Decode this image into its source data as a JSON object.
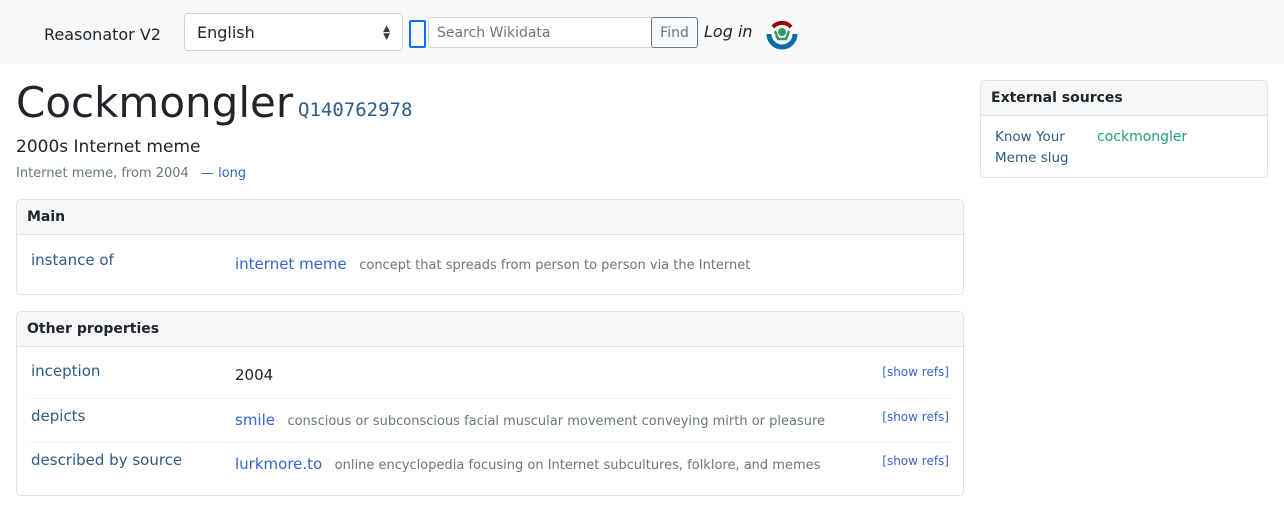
{
  "header": {
    "brand": "Reasonator V2",
    "language": "English",
    "search_placeholder": "Search Wikidata",
    "find_label": "Find",
    "login_label": "Log in"
  },
  "item": {
    "title": "Cockmongler",
    "qid": "Q140762978",
    "subtitle": "2000s Internet meme",
    "description": "Internet meme, from 2004",
    "long_link": "— long"
  },
  "main": {
    "header": "Main",
    "rows": [
      {
        "prop": "instance of",
        "value": "internet meme",
        "desc": "concept that spreads from person to person via the Internet"
      }
    ]
  },
  "other": {
    "header": "Other properties",
    "rows": [
      {
        "prop": "inception",
        "value": "2004",
        "desc": "",
        "refs": "[show refs]"
      },
      {
        "prop": "depicts",
        "value": "smile",
        "desc": "conscious or subconscious facial muscular movement conveying mirth or pleasure",
        "refs": "[show refs]"
      },
      {
        "prop": "described by source",
        "value": "lurkmore.to",
        "desc": "online encyclopedia focusing on Internet subcultures, folklore, and memes",
        "refs": "[show refs]"
      }
    ]
  },
  "external": {
    "header": "External sources",
    "rows": [
      {
        "label": "Know Your Meme slug",
        "value": "cockmongler"
      }
    ]
  },
  "colors": {
    "link": "#3366cc",
    "prop": "#2e5a88",
    "external_value": "#20a080",
    "header_bg": "#f8f9fa"
  }
}
